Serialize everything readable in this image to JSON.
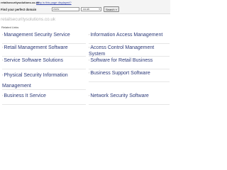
{
  "topbar": {
    "domain": "retailsecuritysolutions.co.uk",
    "why_link": "Why is this page displayed?",
    "find_label": "Find your perfect domain",
    "search_value": "www.",
    "tld_value": ".co.uk",
    "search_button": "Search »"
  },
  "site_title": "retailsecuritysolutions.co.uk",
  "related_label": "Related Links",
  "arrow_glyph": "›",
  "links": [
    {
      "label": "Management Security Service"
    },
    {
      "label": "Information Access Management"
    },
    {
      "label": "Retail Management Software"
    },
    {
      "label": "Access Control Management System"
    },
    {
      "label": "Service Software Solutions"
    },
    {
      "label": "Software for Retail Business"
    },
    {
      "label": "Physical Security Information Management"
    },
    {
      "label": "Business Support Software"
    },
    {
      "label": "Business It Service"
    },
    {
      "label": "Network Security Software"
    }
  ]
}
